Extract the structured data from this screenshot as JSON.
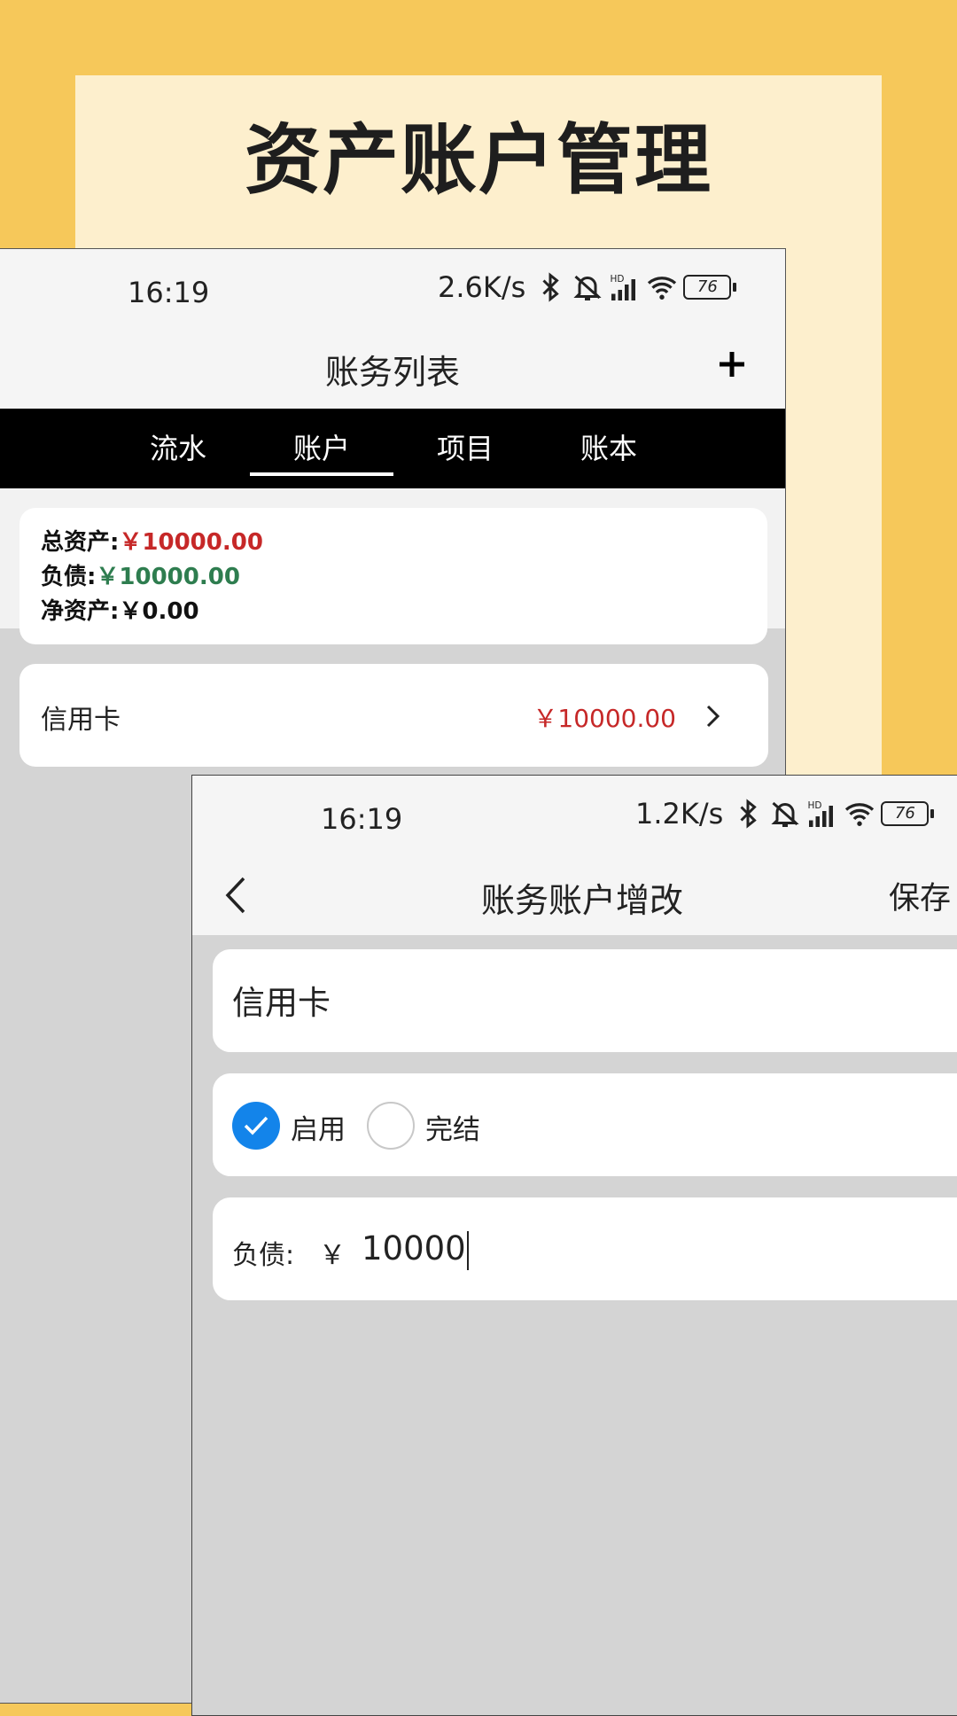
{
  "promo": {
    "title": "资产账户管理"
  },
  "phone1": {
    "status": {
      "time": "16:19",
      "speed": "2.6K/s",
      "battery": "76"
    },
    "title": "账务列表",
    "tabs": [
      "流水",
      "账户",
      "项目",
      "账本"
    ],
    "active_tab": 1,
    "summary": {
      "total_label": "总资产:",
      "total_value": "￥10000.00",
      "debt_label": "负债:",
      "debt_value": "￥10000.00",
      "net_label": "净资产:",
      "net_value": "￥0.00"
    },
    "account": {
      "name": "信用卡",
      "amount": "￥10000.00"
    }
  },
  "phone2": {
    "status": {
      "time": "16:19",
      "speed": "1.2K/s",
      "battery": "76"
    },
    "title": "账务账户增改",
    "save_label": "保存",
    "name_value": "信用卡",
    "radios": [
      {
        "label": "启用",
        "checked": true
      },
      {
        "label": "完结",
        "checked": false
      }
    ],
    "debt": {
      "label": "负债:",
      "currency": "￥",
      "value": "10000"
    }
  },
  "colors": {
    "accent": "#1384ea",
    "negative": "#c62828",
    "positive": "#2e7d4f",
    "background": "#f6c85a",
    "panel": "#fdefcd"
  }
}
